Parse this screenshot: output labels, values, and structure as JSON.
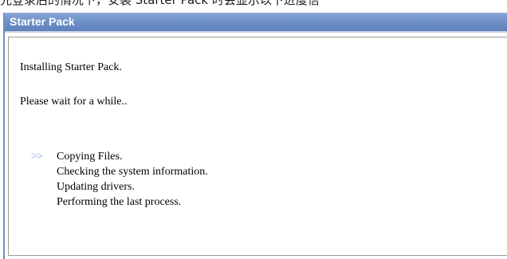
{
  "background_text": "先登录后的情况下，安装 Starter Pack 时会显示以下进度信",
  "window": {
    "title": "Starter Pack",
    "title_color": "#ffffff",
    "titlebar_color": "#6e90c8"
  },
  "content": {
    "message_installing": "Installing Starter Pack.",
    "message_wait": "Please wait for a while..",
    "current_marker": ">>",
    "marker_color": "#7d99dc",
    "steps": [
      {
        "label": "Copying Files.",
        "current": true
      },
      {
        "label": "Checking the system information.",
        "current": false
      },
      {
        "label": "Updating drivers.",
        "current": false
      },
      {
        "label": "Performing the last process.",
        "current": false
      }
    ]
  }
}
